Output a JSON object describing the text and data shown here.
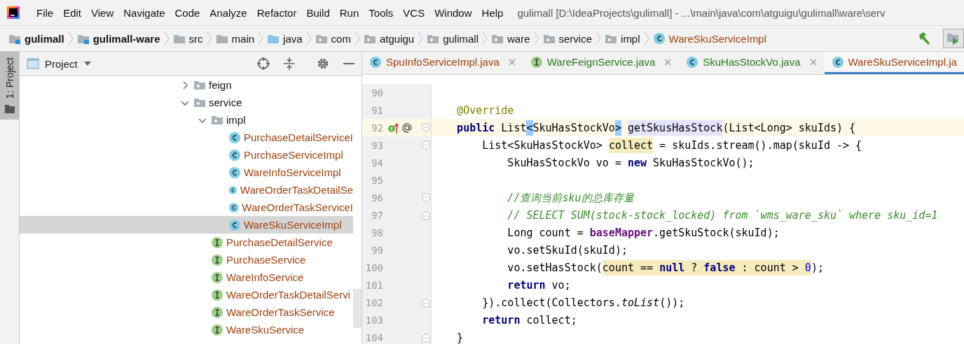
{
  "menu": [
    "File",
    "Edit",
    "View",
    "Navigate",
    "Code",
    "Analyze",
    "Refactor",
    "Build",
    "Run",
    "Tools",
    "VCS",
    "Window",
    "Help"
  ],
  "window": {
    "title": "gulimall [D:\\IdeaProjects\\gulimall] - ...\\main\\java\\com\\atguigu\\gulimall\\ware\\serv"
  },
  "breadcrumbs": [
    {
      "label": "gulimall",
      "kind": "module"
    },
    {
      "label": "gulimall-ware",
      "kind": "module"
    },
    {
      "label": "src",
      "kind": "folder"
    },
    {
      "label": "main",
      "kind": "folder"
    },
    {
      "label": "java",
      "kind": "source"
    },
    {
      "label": "com",
      "kind": "package"
    },
    {
      "label": "atguigu",
      "kind": "package"
    },
    {
      "label": "gulimall",
      "kind": "package"
    },
    {
      "label": "ware",
      "kind": "package"
    },
    {
      "label": "service",
      "kind": "package"
    },
    {
      "label": "impl",
      "kind": "package"
    },
    {
      "label": "WareSkuServiceImpl",
      "kind": "class"
    }
  ],
  "side_stripe": {
    "label": "1: Project"
  },
  "project_panel": {
    "title": "Project",
    "tree": [
      {
        "label": "feign",
        "kind": "package",
        "expanded": false,
        "selected": false
      },
      {
        "label": "service",
        "kind": "package",
        "expanded": true,
        "selected": false,
        "children": [
          {
            "label": "impl",
            "kind": "package",
            "expanded": true,
            "selected": false,
            "children": [
              {
                "label": "PurchaseDetailServiceI",
                "kind": "class",
                "selected": false
              },
              {
                "label": "PurchaseServiceImpl",
                "kind": "class",
                "selected": false
              },
              {
                "label": "WareInfoServiceImpl",
                "kind": "class",
                "selected": false
              },
              {
                "label": "WareOrderTaskDetailSe",
                "kind": "class",
                "selected": false
              },
              {
                "label": "WareOrderTaskServiceI",
                "kind": "class",
                "selected": false
              },
              {
                "label": "WareSkuServiceImpl",
                "kind": "class",
                "selected": true
              }
            ]
          },
          {
            "label": "PurchaseDetailService",
            "kind": "interface",
            "selected": false
          },
          {
            "label": "PurchaseService",
            "kind": "interface",
            "selected": false
          },
          {
            "label": "WareInfoService",
            "kind": "interface",
            "selected": false
          },
          {
            "label": "WareOrderTaskDetailServi",
            "kind": "interface",
            "selected": false
          },
          {
            "label": "WareOrderTaskService",
            "kind": "interface",
            "selected": false
          },
          {
            "label": "WareSkuService",
            "kind": "interface",
            "selected": false
          }
        ]
      }
    ]
  },
  "editor_tabs": [
    {
      "label": "SpuInfoServiceImpl.java",
      "kind": "class",
      "color": "#a0410d",
      "selected": false
    },
    {
      "label": "WareFeignService.java",
      "kind": "interface",
      "color": "#297a1d",
      "selected": false
    },
    {
      "label": "SkuHasStockVo.java",
      "kind": "class",
      "color": "#297a1d",
      "selected": false
    },
    {
      "label": "WareSkuServiceImpl.ja",
      "kind": "class",
      "color": "#a0410d",
      "selected": true
    }
  ],
  "code": [
    {
      "number": "90",
      "current": false
    },
    {
      "number": "91",
      "current": false,
      "tokens": [
        {
          "text": "    @Override",
          "kind": "annotation"
        }
      ]
    },
    {
      "number": "92",
      "current": true,
      "markers": true,
      "fold_start": true,
      "tokens": [
        {
          "text": "    public",
          "kind": "keyword"
        },
        {
          "text": " List",
          "kind": "plain"
        },
        {
          "text": "<",
          "kind": "plain",
          "brace_match": true
        },
        {
          "text": "SkuHasStockVo",
          "kind": "plain"
        },
        {
          "text": ">",
          "kind": "plain",
          "brace_match": true
        },
        {
          "text": "getSkusHasStock",
          "kind": "plain",
          "declaration_highlight": true
        },
        {
          "text": "(List<Long> skuIds) {",
          "kind": "plain"
        }
      ]
    },
    {
      "number": "93",
      "current": false,
      "fold_start": true,
      "tokens": [
        {
          "text": "        List<SkuHasStockVo> ",
          "kind": "plain"
        },
        {
          "text": "collect",
          "kind": "plain",
          "usage_highlight": true
        },
        {
          "text": " = skuIds.stream().map(skuId -> {",
          "kind": "plain"
        }
      ]
    },
    {
      "number": "94",
      "current": false,
      "tokens": [
        {
          "text": "            SkuHasStockVo vo = ",
          "kind": "plain"
        },
        {
          "text": "new",
          "kind": "keyword"
        },
        {
          "text": " SkuHasStockVo();",
          "kind": "plain"
        }
      ]
    },
    {
      "number": "95",
      "current": false
    },
    {
      "number": "96",
      "current": false,
      "fold_start": true,
      "tokens": [
        {
          "text": "            //查询当前sku的总库存量",
          "kind": "comment"
        }
      ]
    },
    {
      "number": "97",
      "current": false,
      "fold_end": true,
      "tokens": [
        {
          "text": "            // SELECT SUM(stock-stock_locked) from `wms_ware_sku` where sku_id=1",
          "kind": "comment"
        }
      ]
    },
    {
      "number": "98",
      "current": false,
      "tokens": [
        {
          "text": "            Long count = ",
          "kind": "plain"
        },
        {
          "text": "baseMapper",
          "kind": "field"
        },
        {
          "text": ".getSkuStock(skuId);",
          "kind": "plain"
        }
      ]
    },
    {
      "number": "99",
      "current": false,
      "tokens": [
        {
          "text": "            vo.setSkuId(skuId);",
          "kind": "plain"
        }
      ]
    },
    {
      "number": "100",
      "current": false,
      "tokens": [
        {
          "text": "            vo.setHasStock(",
          "kind": "plain"
        },
        {
          "text": "count == ",
          "kind": "plain",
          "usage_highlight": true
        },
        {
          "text": "null",
          "kind": "keyword",
          "usage_highlight": true
        },
        {
          "text": " ? ",
          "kind": "plain",
          "usage_highlight": true
        },
        {
          "text": "false",
          "kind": "keyword",
          "usage_highlight": true
        },
        {
          "text": " : count > ",
          "kind": "plain",
          "usage_highlight": true
        },
        {
          "text": "0",
          "kind": "number",
          "usage_highlight": true
        },
        {
          "text": ");",
          "kind": "plain"
        }
      ]
    },
    {
      "number": "101",
      "current": false,
      "tokens": [
        {
          "text": "            return",
          "kind": "keyword"
        },
        {
          "text": " vo;",
          "kind": "plain"
        }
      ]
    },
    {
      "number": "102",
      "current": false,
      "fold_end": true,
      "tokens": [
        {
          "text": "        }).collect(Collectors.",
          "kind": "plain"
        },
        {
          "text": "toList",
          "kind": "static"
        },
        {
          "text": "());",
          "kind": "plain"
        }
      ]
    },
    {
      "number": "103",
      "current": false,
      "tokens": [
        {
          "text": "        return",
          "kind": "keyword"
        },
        {
          "text": " collect;",
          "kind": "plain"
        }
      ]
    },
    {
      "number": "104",
      "current": false,
      "fold_end": true,
      "tokens": [
        {
          "text": "    }",
          "kind": "plain"
        }
      ]
    }
  ]
}
